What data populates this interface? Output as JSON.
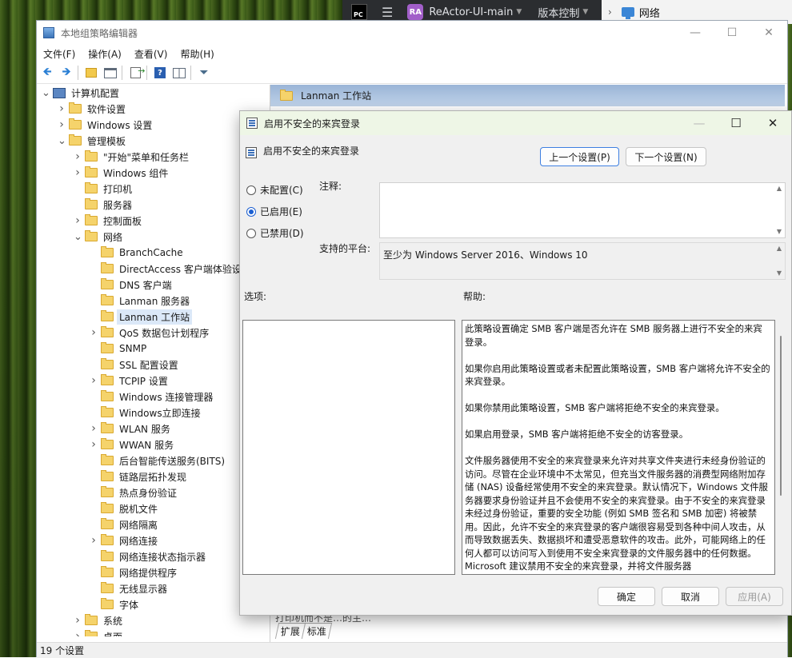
{
  "ide": {
    "logo": "PC",
    "project_badge": "RA",
    "project_name": "ReActor-UI-main",
    "vcs_label": "版本控制"
  },
  "explorer": {
    "location": "网络"
  },
  "main_window": {
    "title": "本地组策略编辑器",
    "menu": [
      "文件(F)",
      "操作(A)",
      "查看(V)",
      "帮助(H)"
    ],
    "status": "19 个设置"
  },
  "tree": [
    {
      "label": "计算机配置",
      "level": 0,
      "expander": "open",
      "icon": "computer-icon"
    },
    {
      "label": "软件设置",
      "level": 1,
      "expander": "closed",
      "icon": "folder-icon"
    },
    {
      "label": "Windows 设置",
      "level": 1,
      "expander": "closed",
      "icon": "folder-icon"
    },
    {
      "label": "管理模板",
      "level": 1,
      "expander": "open",
      "icon": "folder-icon"
    },
    {
      "label": "\"开始\"菜单和任务栏",
      "level": 2,
      "expander": "closed",
      "icon": "folder-icon"
    },
    {
      "label": "Windows 组件",
      "level": 2,
      "expander": "closed",
      "icon": "folder-icon"
    },
    {
      "label": "打印机",
      "level": 2,
      "expander": "none",
      "icon": "folder-icon"
    },
    {
      "label": "服务器",
      "level": 2,
      "expander": "none",
      "icon": "folder-icon"
    },
    {
      "label": "控制面板",
      "level": 2,
      "expander": "closed",
      "icon": "folder-icon"
    },
    {
      "label": "网络",
      "level": 2,
      "expander": "open",
      "icon": "folder-icon"
    },
    {
      "label": "BranchCache",
      "level": 3,
      "expander": "none",
      "icon": "folder-icon"
    },
    {
      "label": "DirectAccess 客户端体验设置",
      "level": 3,
      "expander": "none",
      "icon": "folder-icon"
    },
    {
      "label": "DNS 客户端",
      "level": 3,
      "expander": "none",
      "icon": "folder-icon"
    },
    {
      "label": "Lanman 服务器",
      "level": 3,
      "expander": "none",
      "icon": "folder-icon"
    },
    {
      "label": "Lanman 工作站",
      "level": 3,
      "expander": "none",
      "icon": "folder-icon",
      "selected": true
    },
    {
      "label": "QoS 数据包计划程序",
      "level": 3,
      "expander": "closed",
      "icon": "folder-icon"
    },
    {
      "label": "SNMP",
      "level": 3,
      "expander": "none",
      "icon": "folder-icon"
    },
    {
      "label": "SSL 配置设置",
      "level": 3,
      "expander": "none",
      "icon": "folder-icon"
    },
    {
      "label": "TCPIP 设置",
      "level": 3,
      "expander": "closed",
      "icon": "folder-icon"
    },
    {
      "label": "Windows 连接管理器",
      "level": 3,
      "expander": "none",
      "icon": "folder-icon"
    },
    {
      "label": "Windows立即连接",
      "level": 3,
      "expander": "none",
      "icon": "folder-icon"
    },
    {
      "label": "WLAN 服务",
      "level": 3,
      "expander": "closed",
      "icon": "folder-icon"
    },
    {
      "label": "WWAN 服务",
      "level": 3,
      "expander": "closed",
      "icon": "folder-icon"
    },
    {
      "label": "后台智能传送服务(BITS)",
      "level": 3,
      "expander": "none",
      "icon": "folder-icon"
    },
    {
      "label": "链路层拓扑发现",
      "level": 3,
      "expander": "none",
      "icon": "folder-icon"
    },
    {
      "label": "热点身份验证",
      "level": 3,
      "expander": "none",
      "icon": "folder-icon"
    },
    {
      "label": "脱机文件",
      "level": 3,
      "expander": "none",
      "icon": "folder-icon"
    },
    {
      "label": "网络隔离",
      "level": 3,
      "expander": "none",
      "icon": "folder-icon"
    },
    {
      "label": "网络连接",
      "level": 3,
      "expander": "closed",
      "icon": "folder-icon"
    },
    {
      "label": "网络连接状态指示器",
      "level": 3,
      "expander": "none",
      "icon": "folder-icon"
    },
    {
      "label": "网络提供程序",
      "level": 3,
      "expander": "none",
      "icon": "folder-icon"
    },
    {
      "label": "无线显示器",
      "level": 3,
      "expander": "none",
      "icon": "folder-icon"
    },
    {
      "label": "字体",
      "level": 3,
      "expander": "none",
      "icon": "folder-icon"
    },
    {
      "label": "系统",
      "level": 2,
      "expander": "closed",
      "icon": "folder-icon"
    },
    {
      "label": "桌面",
      "level": 2,
      "expander": "closed",
      "icon": "folder-icon"
    }
  ],
  "right_pane": {
    "header": "Lanman 工作站",
    "cut_text": "打印机而不是…的主…",
    "tabs": [
      "扩展",
      "标准"
    ]
  },
  "dialog": {
    "title": "启用不安全的来宾登录",
    "heading": "启用不安全的来宾登录",
    "prev_button": "上一个设置(P)",
    "next_button": "下一个设置(N)",
    "radios": [
      {
        "label": "未配置(C)",
        "checked": false
      },
      {
        "label": "已启用(E)",
        "checked": true
      },
      {
        "label": "已禁用(D)",
        "checked": false
      }
    ],
    "comment_label": "注释:",
    "platform_label": "支持的平台:",
    "platform_value": "至少为 Windows Server 2016、Windows 10",
    "options_label": "选项:",
    "help_label": "帮助:",
    "help_paragraphs": [
      "此策略设置确定 SMB 客户端是否允许在 SMB 服务器上进行不安全的来宾登录。",
      "如果你启用此策略设置或者未配置此策略设置，SMB 客户端将允许不安全的来宾登录。",
      "如果你禁用此策略设置，SMB 客户端将拒绝不安全的来宾登录。",
      "如果启用登录，SMB 客户端将拒绝不安全的访客登录。",
      "文件服务器使用不安全的来宾登录来允许对共享文件夹进行未经身份验证的访问。尽管在企业环境中不太常见，但充当文件服务器的消费型网络附加存储 (NAS) 设备经常使用不安全的来宾登录。默认情况下，Windows 文件服务器要求身份验证并且不会使用不安全的来宾登录。由于不安全的来宾登录未经过身份验证，重要的安全功能 (例如 SMB 签名和 SMB 加密) 将被禁用。因此，允许不安全的来宾登录的客户端很容易受到各种中间人攻击，从而导致数据丢失、数据损坏和遭受恶意软件的攻击。此外，可能网络上的任何人都可以访问写入到使用不安全来宾登录的文件服务器中的任何数据。Microsoft 建议禁用不安全的来宾登录，并将文件服务器"
    ],
    "ok_button": "确定",
    "cancel_button": "取消",
    "apply_button": "应用(A)"
  }
}
